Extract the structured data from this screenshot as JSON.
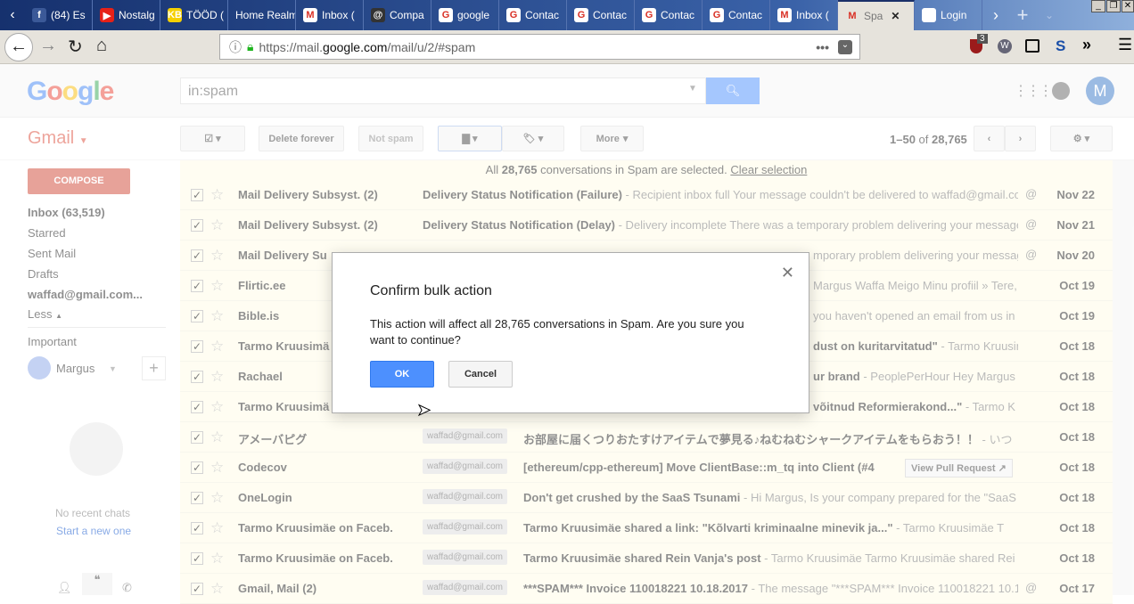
{
  "browser": {
    "tabs": [
      {
        "label": "(84) Es",
        "icon": "facebook-icon",
        "color": "#3b5998",
        "glyph": "f"
      },
      {
        "label": "Nostalg",
        "icon": "youtube-icon",
        "color": "#e62117",
        "glyph": "▶"
      },
      {
        "label": "TÖÖD (",
        "icon": "kb-icon",
        "color": "#f5d000",
        "glyph": "KB"
      },
      {
        "label": "Home Realm",
        "icon": "",
        "color": "",
        "glyph": ""
      },
      {
        "label": "Inbox (",
        "icon": "gmail-100-icon",
        "color": "#fff",
        "glyph": "M"
      },
      {
        "label": "Compa",
        "icon": "w-icon",
        "color": "#333",
        "glyph": "@"
      },
      {
        "label": "google",
        "icon": "google-icon",
        "color": "#fff",
        "glyph": "G"
      },
      {
        "label": "Contac",
        "icon": "google-icon",
        "color": "#fff",
        "glyph": "G"
      },
      {
        "label": "Contac",
        "icon": "google-icon",
        "color": "#fff",
        "glyph": "G"
      },
      {
        "label": "Contac",
        "icon": "google-icon",
        "color": "#fff",
        "glyph": "G"
      },
      {
        "label": "Contac",
        "icon": "google-icon",
        "color": "#fff",
        "glyph": "G"
      },
      {
        "label": "Inbox (",
        "icon": "gmail-100-icon",
        "color": "#fff",
        "glyph": "M"
      },
      {
        "label": "Spa",
        "icon": "gmail-icon",
        "color": "#e6e3dc",
        "glyph": "M",
        "active": true
      },
      {
        "label": "Login",
        "icon": "page-icon",
        "color": "#fff",
        "glyph": ""
      }
    ],
    "url_prefix": "https://mail.",
    "url_domain": "google.com",
    "url_path": "/mail/u/2/#spam",
    "ublock_badge": "3"
  },
  "gmail": {
    "logo": "Google",
    "search_value": "in:spam",
    "app_label": "Gmail",
    "avatar_letter": "M",
    "toolbar": {
      "delete_forever": "Delete forever",
      "not_spam": "Not spam",
      "more": "More",
      "range": "1–50",
      "of": "of",
      "total": "28,765"
    },
    "compose": "COMPOSE",
    "nav": {
      "inbox": "Inbox (63,519)",
      "starred": "Starred",
      "sent": "Sent Mail",
      "drafts": "Drafts",
      "account": "waffad@gmail.com...",
      "less": "Less",
      "important": "Important"
    },
    "chat": {
      "user": "Margus",
      "no_chats": "No recent chats",
      "start": "Start a new one"
    },
    "selection": {
      "pre": "All",
      "count": "28,765",
      "post": "conversations in Spam are selected.",
      "clear": "Clear selection"
    },
    "rows": [
      {
        "sender": "Mail Delivery Subsyst. (2)",
        "label": "",
        "subject": "Delivery Status Notification (Failure)",
        "snippet": " - Recipient inbox full Your message couldn't be delivered to waffad@gmail.co",
        "attach": true,
        "date": "Nov 22"
      },
      {
        "sender": "Mail Delivery Subsyst. (2)",
        "label": "",
        "subject": "Delivery Status Notification (Delay)",
        "snippet": " - Delivery incomplete There was a temporary problem delivering your message",
        "attach": true,
        "date": "Nov 21"
      },
      {
        "sender": "Mail Delivery Su",
        "label": "",
        "subject": "",
        "snippet": "mporary problem delivering your messag",
        "attach": true,
        "date": "Nov 20",
        "hidden": true
      },
      {
        "sender": "Flirtic.ee",
        "label": "",
        "subject": "",
        "snippet": "Margus Waffa Meigo Minu profiil » Tere,",
        "date": "Oct 19",
        "hidden": true
      },
      {
        "sender": "Bible.is",
        "label": "",
        "subject": "",
        "snippet": "you haven't opened an email from us in a",
        "date": "Oct 19",
        "hidden": true
      },
      {
        "sender": "Tarmo Kruusimä",
        "label": "",
        "subject": "dust on kuritarvitatud\"",
        "snippet": " - Tarmo Kruusim",
        "date": "Oct 18",
        "hidden": true
      },
      {
        "sender": "Rachael",
        "label": "",
        "subject": "ur brand",
        "snippet": " - PeoplePerHour Hey Margus V",
        "date": "Oct 18",
        "hidden": true
      },
      {
        "sender": "Tarmo Kruusimä",
        "label": "",
        "subject": "võitnud Reformierakond...\"",
        "snippet": " - Tarmo K",
        "date": "Oct 18",
        "hidden": true
      },
      {
        "sender": "アメーバピグ",
        "label": "waffad@gmail.com",
        "subject": "お部屋に届くつりおたすけアイテムで夢見る♪ねむねむシャークアイテムをもらおう！！",
        "snippet": " - いつ",
        "date": "Oct 18"
      },
      {
        "sender": "Codecov",
        "label": "waffad@gmail.com",
        "subject": "[ethereum/cpp-ethereum] Move ClientBase::m_tq into Client (#4",
        "snippet": "",
        "button": "View Pull Request ↗",
        "date": "Oct 18"
      },
      {
        "sender": "OneLogin",
        "label": "waffad@gmail.com",
        "subject": "Don't get crushed by the SaaS Tsunami",
        "snippet": " - Hi Margus, Is your company prepared for the \"SaaS",
        "date": "Oct 18"
      },
      {
        "sender": "Tarmo Kruusimäe on Faceb.",
        "label": "waffad@gmail.com",
        "subject": "Tarmo Kruusimäe shared a link: \"Kõlvarti kriminaalne minevik ja...\"",
        "snippet": " - Tarmo Kruusimäe T",
        "date": "Oct 18"
      },
      {
        "sender": "Tarmo Kruusimäe on Faceb.",
        "label": "waffad@gmail.com",
        "subject": "Tarmo Kruusimäe shared Rein Vanja's post",
        "snippet": " - Tarmo Kruusimäe Tarmo Kruusimäe shared Rei",
        "date": "Oct 18"
      },
      {
        "sender": "Gmail, Mail (2)",
        "label": "waffad@gmail.com",
        "subject": "***SPAM*** Invoice 110018221 10.18.2017",
        "snippet": " - The message \"***SPAM*** Invoice 110018221 10.1",
        "attach": true,
        "date": "Oct 17"
      }
    ]
  },
  "dialog": {
    "title": "Confirm bulk action",
    "message": "This action will affect all 28,765 conversations in Spam. Are you sure you want to continue?",
    "ok": "OK",
    "cancel": "Cancel"
  }
}
